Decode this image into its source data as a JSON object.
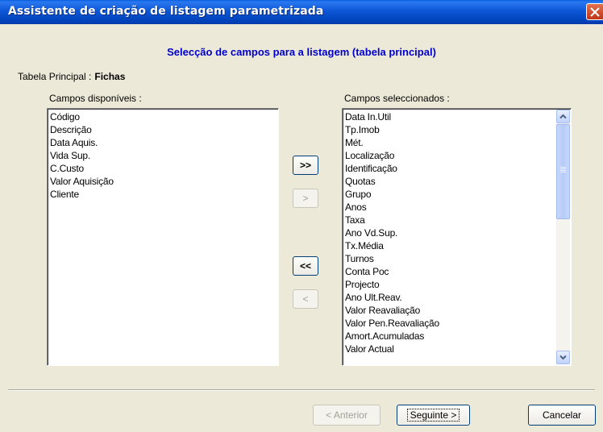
{
  "window": {
    "title": "Assistente de criação de listagem parametrizada"
  },
  "heading": "Selecção de campos para a listagem (tabela principal)",
  "main_table": {
    "label": "Tabela Principal :",
    "value": "Fichas"
  },
  "available": {
    "caption": "Campos disponíveis :",
    "items": [
      "Código",
      "Descrição",
      "Data Aquis.",
      "Vida Sup.",
      "C.Custo",
      "Valor Aquisição",
      "Cliente"
    ]
  },
  "selected": {
    "caption": "Campos seleccionados :",
    "items": [
      "Data In.Util",
      "Tp.Imob",
      "Mét.",
      "Localização",
      "Identificação",
      "Quotas",
      "Grupo",
      "Anos",
      "Taxa",
      "Ano Vd.Sup.",
      "Tx.Média",
      "Turnos",
      "Conta Poc",
      "Projecto",
      "Ano Ult.Reav.",
      "Valor Reavaliação",
      "Valor Pen.Reavaliação",
      "Amort.Acumuladas",
      "Valor Actual"
    ]
  },
  "move_buttons": {
    "add_all": ">>",
    "add_one": ">",
    "remove_all": "<<",
    "remove_one": "<"
  },
  "footer": {
    "back": "< Anterior",
    "next": "Seguinte >",
    "cancel": "Cancelar"
  },
  "colors": {
    "title_bar": "#0040b8",
    "heading_text": "#0000cc",
    "dialog_bg": "#ece9d8"
  }
}
